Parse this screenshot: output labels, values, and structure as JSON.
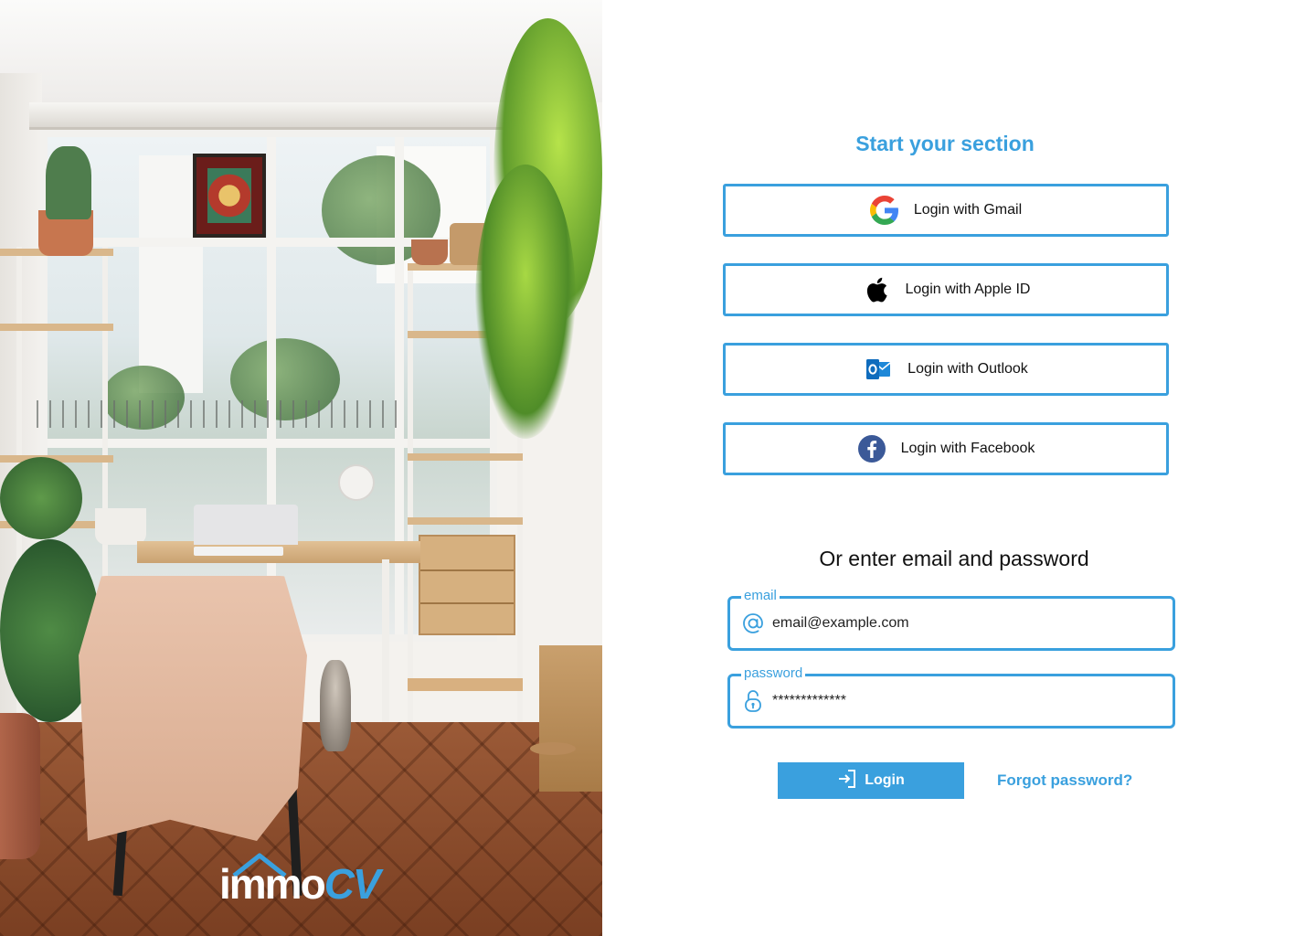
{
  "brand": {
    "part1": "immo",
    "part2": "CV",
    "accent_color": "#3aa0de"
  },
  "form": {
    "heading": "Start your section",
    "social_buttons": [
      {
        "label": "Login with Gmail",
        "icon": "google-icon"
      },
      {
        "label": "Login with Apple ID",
        "icon": "apple-icon"
      },
      {
        "label": "Login with Outlook",
        "icon": "outlook-icon"
      },
      {
        "label": "Login with Facebook",
        "icon": "facebook-icon"
      }
    ],
    "divider_text": "Or enter email and password",
    "email": {
      "label": "email",
      "value": "email@example.com",
      "icon": "at-icon"
    },
    "password": {
      "label": "password",
      "value": "*************",
      "icon": "lock-icon"
    },
    "login_button": {
      "label": "Login",
      "icon": "login-arrow-icon"
    },
    "forgot_link": "Forgot password?"
  }
}
